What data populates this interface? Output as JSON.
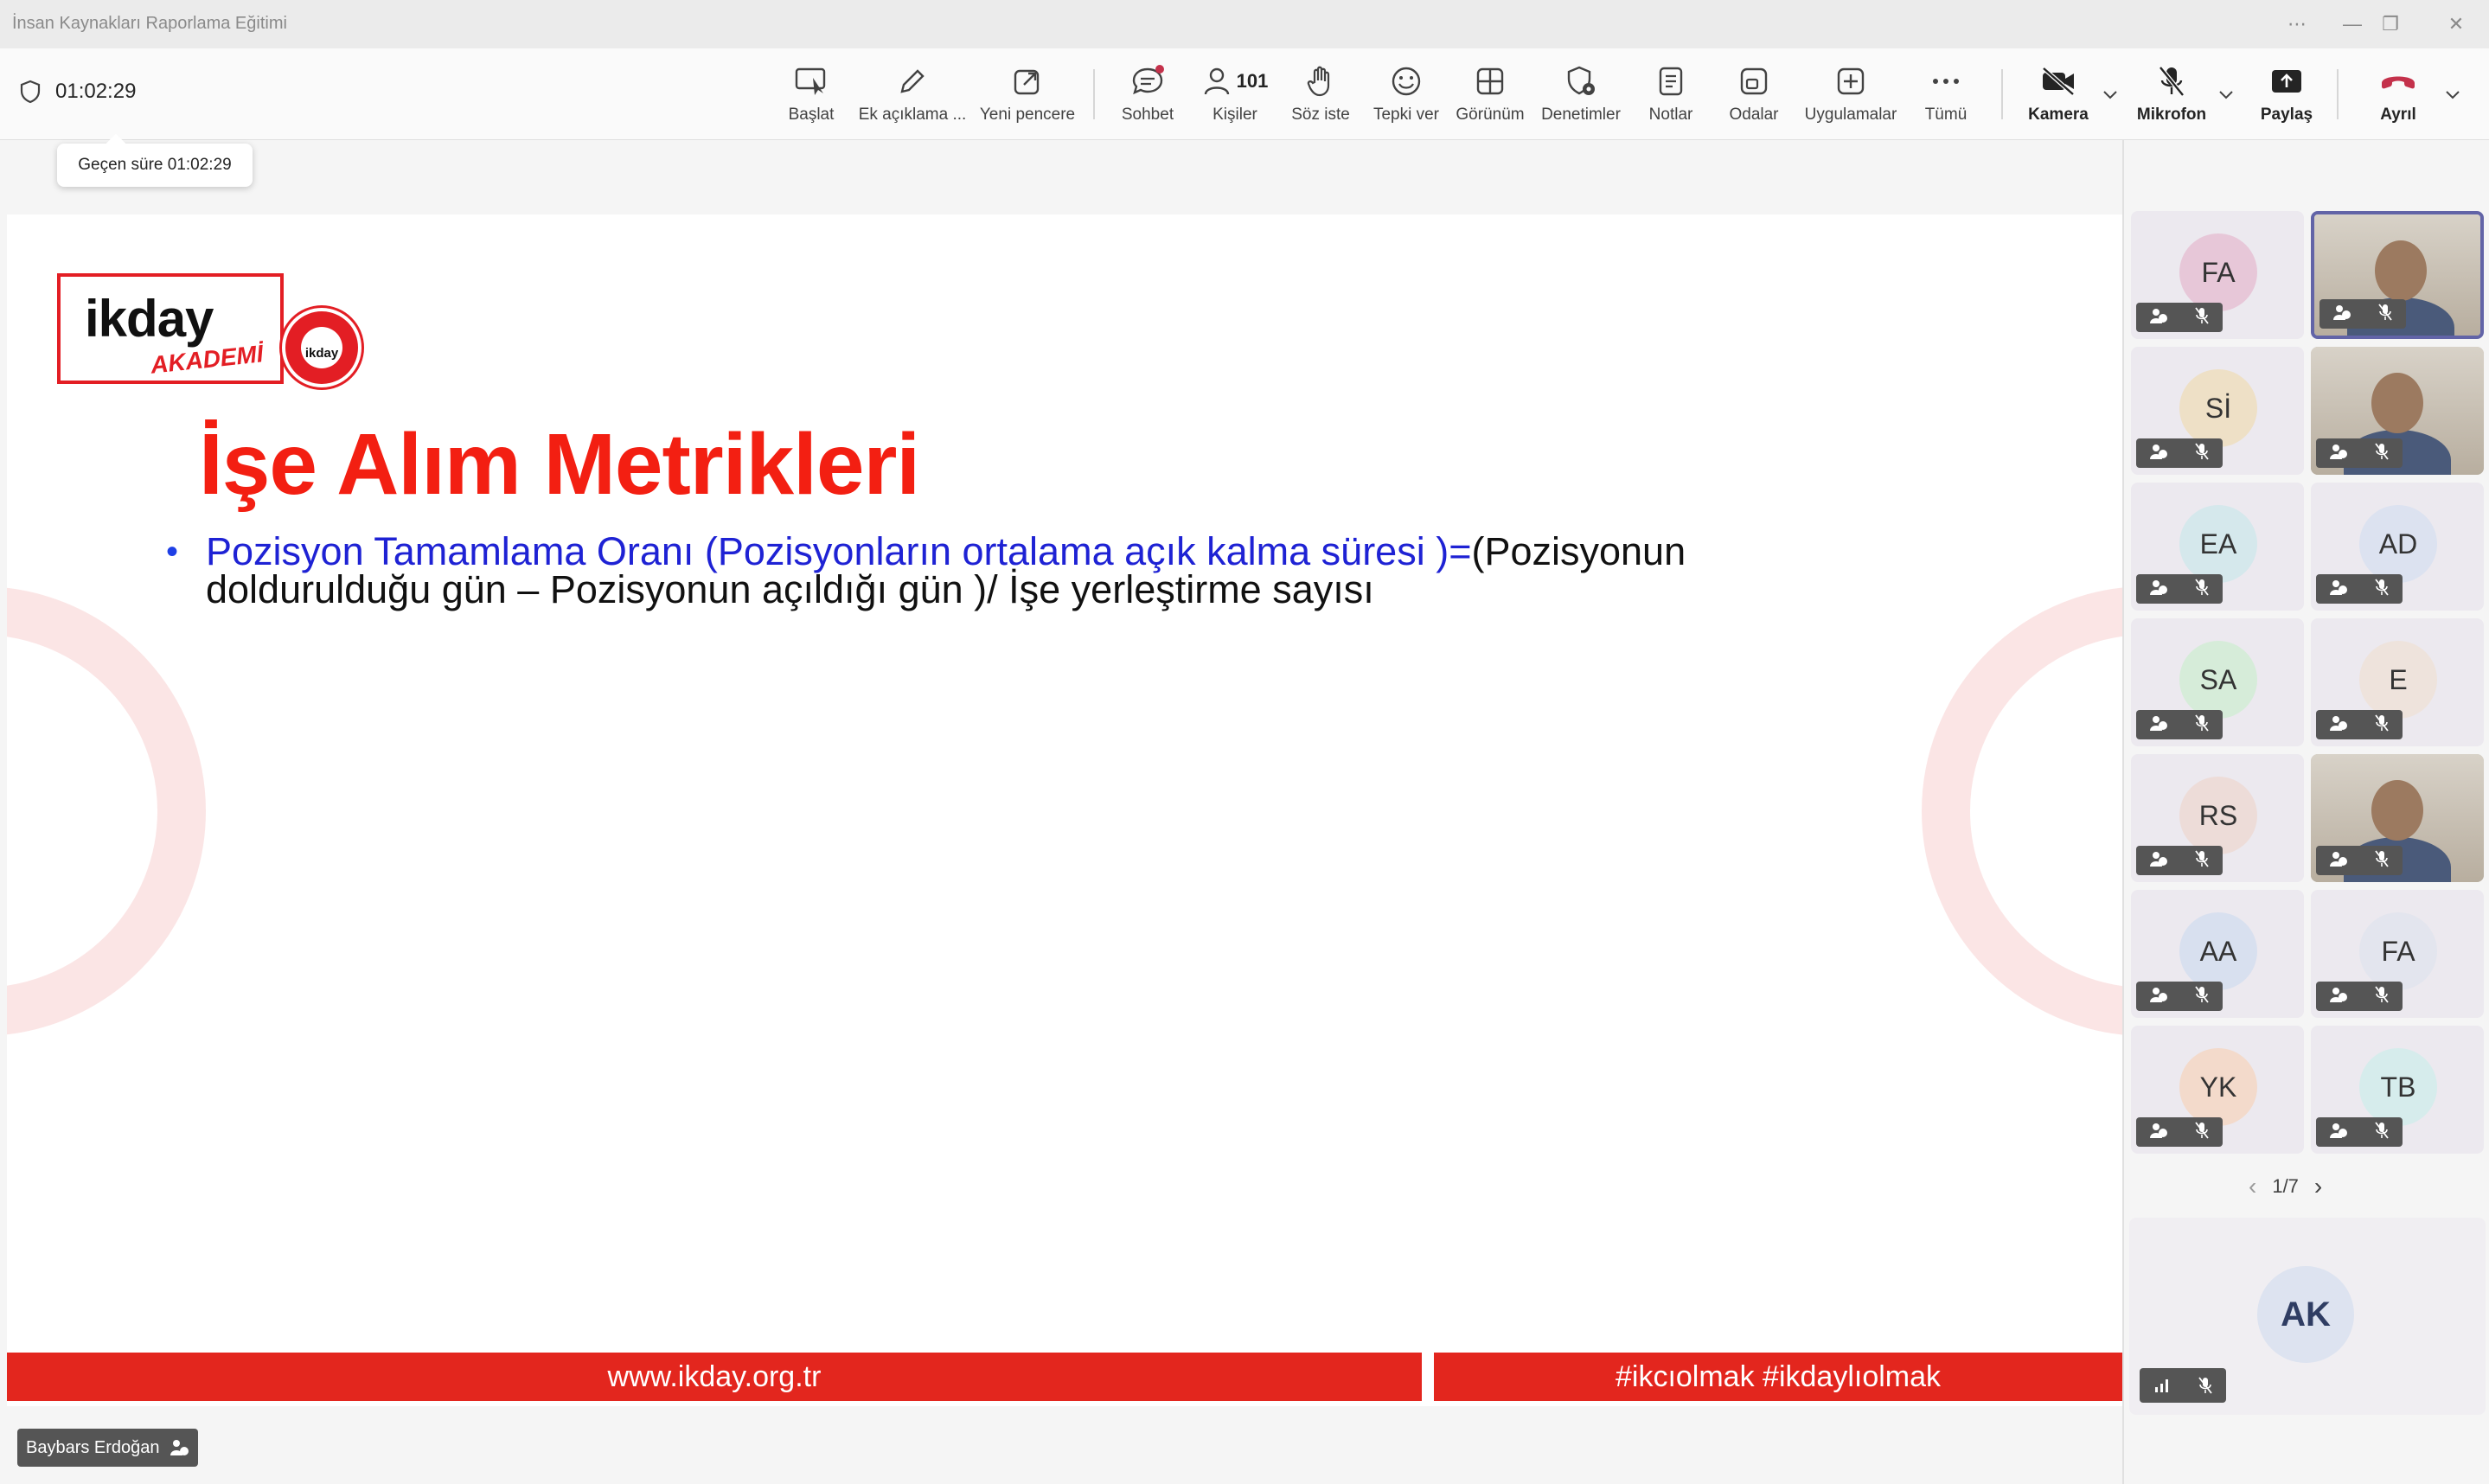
{
  "window": {
    "title": "İnsan Kaynakları Raporlama Eğitimi"
  },
  "meeting": {
    "timer": "01:02:29",
    "tooltip": "Geçen süre 01:02:29"
  },
  "toolbar": {
    "start": "Başlat",
    "annotate": "Ek açıklama ...",
    "new_window": "Yeni pencere",
    "chat": "Sohbet",
    "people": "Kişiler",
    "people_count": "101",
    "raise_hand": "Söz iste",
    "react": "Tepki ver",
    "view": "Görünüm",
    "controls": "Denetimler",
    "notes": "Notlar",
    "rooms": "Odalar",
    "apps": "Uygulamalar",
    "more": "Tümü",
    "camera": "Kamera",
    "mic": "Mikrofon",
    "share": "Paylaş",
    "leave": "Ayrıl"
  },
  "slide": {
    "logo_word": "ikday",
    "logo_sub": "AKADEMİ",
    "seal_text": "ikday",
    "title": "İşe Alım Metrikleri",
    "bullet_blue": "Pozisyon Tamamlama Oranı (Pozisyonların ortalama açık kalma süresi )=",
    "bullet_black": "(Pozisyonun doldurulduğu gün – Pozisyonun açıldığı gün )/ İşe yerleştirme sayısı",
    "footer_left": "www.ikday.org.tr",
    "footer_right": "#ikcıolmak #ikdaylıolmak"
  },
  "presenter": {
    "name": "Baybars Erdoğan"
  },
  "participants": [
    {
      "initials": "FA",
      "color": "#e7c7d8"
    },
    {
      "initials": "",
      "video": true,
      "selected": true
    },
    {
      "initials": "Sİ",
      "color": "#eee0c6"
    },
    {
      "initials": "",
      "video": true
    },
    {
      "initials": "EA",
      "color": "#d5e8ec"
    },
    {
      "initials": "AD",
      "color": "#dce2f0"
    },
    {
      "initials": "SA",
      "color": "#d6ecd9"
    },
    {
      "initials": "E",
      "color": "#eee3dc"
    },
    {
      "initials": "RS",
      "color": "#eddcd8"
    },
    {
      "initials": "",
      "video": true
    },
    {
      "initials": "AA",
      "color": "#d8e0ef"
    },
    {
      "initials": "FA",
      "color": "#e3e5ee"
    },
    {
      "initials": "YK",
      "color": "#f3dacb"
    },
    {
      "initials": "TB",
      "color": "#d6ecec"
    }
  ],
  "pager": {
    "label": "1/7"
  },
  "spotlight": {
    "initials": "AK"
  }
}
